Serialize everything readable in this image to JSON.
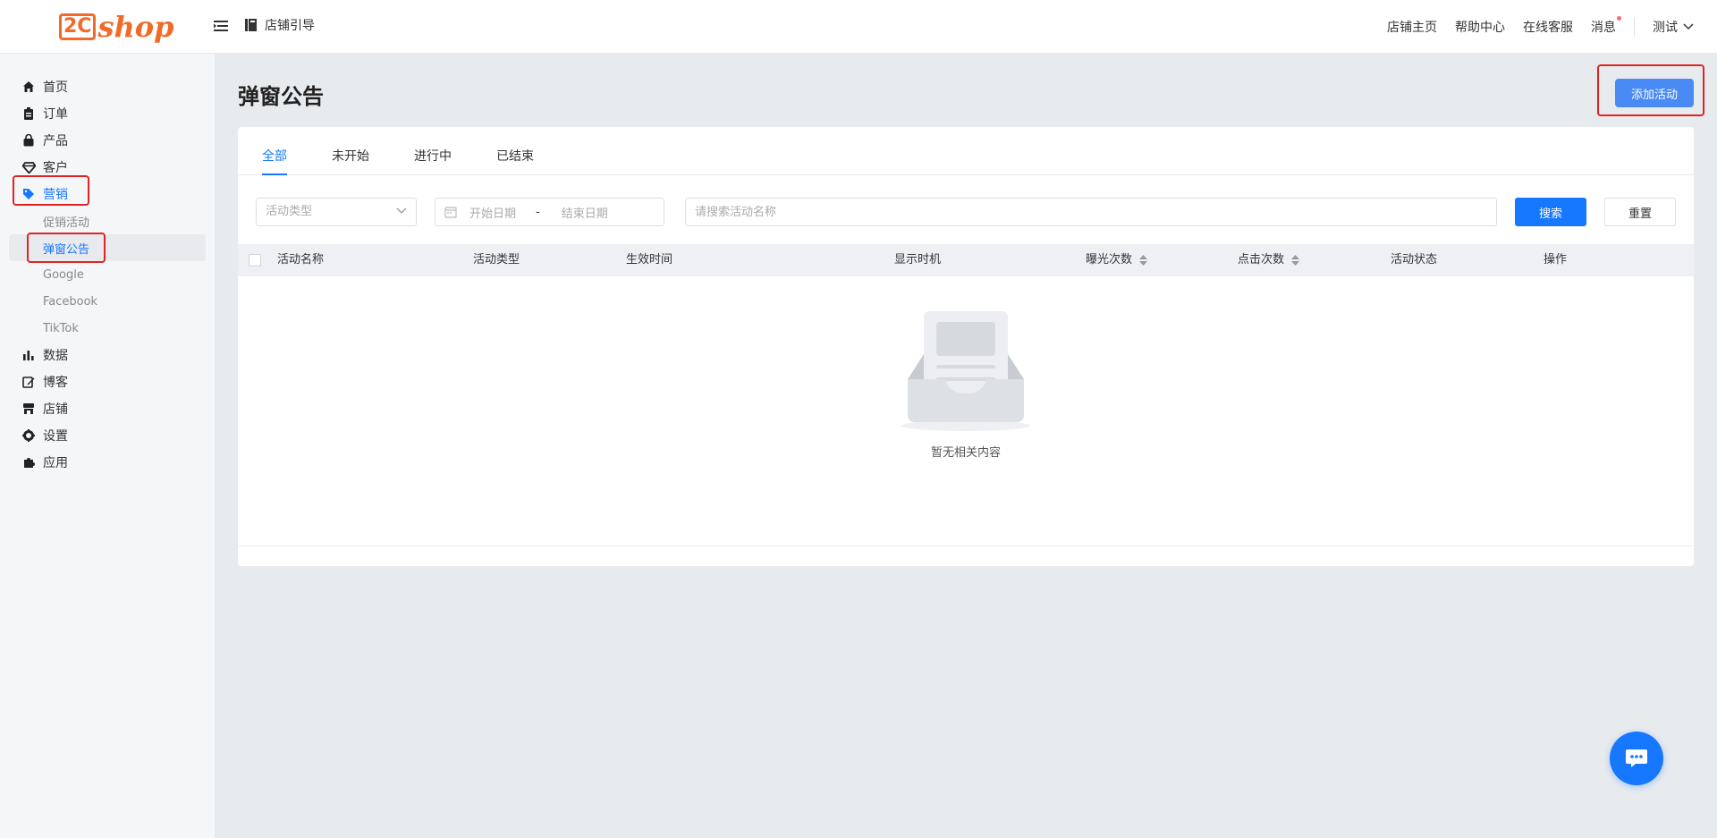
{
  "brand": {
    "logo_mark": "2C",
    "logo_text": "shop",
    "accent": "#f26a2a"
  },
  "header": {
    "breadcrumb": "店铺引导",
    "links": {
      "store_home": "店铺主页",
      "help_center": "帮助中心",
      "online_service": "在线客服",
      "messages": "消息"
    },
    "user": "测试"
  },
  "sidebar": {
    "items": [
      {
        "label": "首页",
        "icon": "home-icon"
      },
      {
        "label": "订单",
        "icon": "clipboard-icon"
      },
      {
        "label": "产品",
        "icon": "shopping-bag-icon"
      },
      {
        "label": "客户",
        "icon": "diamond-icon"
      },
      {
        "label": "营销",
        "icon": "tag-icon",
        "active": true
      },
      {
        "label": "数据",
        "icon": "bar-chart-icon"
      },
      {
        "label": "博客",
        "icon": "edit-icon"
      },
      {
        "label": "店铺",
        "icon": "store-icon"
      },
      {
        "label": "设置",
        "icon": "gear-icon"
      },
      {
        "label": "应用",
        "icon": "puzzle-icon"
      }
    ],
    "marketing_sub": [
      {
        "label": "促销活动"
      },
      {
        "label": "弹窗公告",
        "active": true
      },
      {
        "label": "Google"
      },
      {
        "label": "Facebook"
      },
      {
        "label": "TikTok"
      }
    ]
  },
  "main": {
    "title": "弹窗公告",
    "add_button": "添加活动",
    "tabs": [
      {
        "label": "全部",
        "active": true
      },
      {
        "label": "未开始"
      },
      {
        "label": "进行中"
      },
      {
        "label": "已结束"
      }
    ],
    "filters": {
      "type_placeholder": "活动类型",
      "start_date": "开始日期",
      "date_sep": "-",
      "end_date": "结束日期",
      "search_placeholder": "请搜索活动名称",
      "search_button": "搜索",
      "reset_button": "重置"
    },
    "table": {
      "columns": [
        "活动名称",
        "活动类型",
        "生效时间",
        "显示时机",
        "曝光次数",
        "点击次数",
        "活动状态",
        "操作"
      ],
      "empty_text": "暂无相关内容"
    }
  },
  "colors": {
    "primary": "#1677ff",
    "highlight_box": "#e02424"
  }
}
